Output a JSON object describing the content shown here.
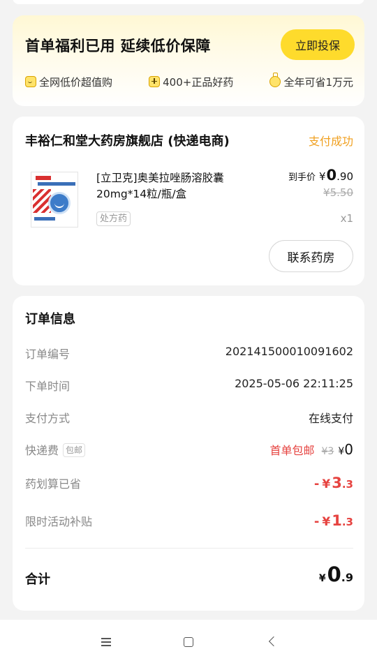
{
  "promo": {
    "title": "首单福利已用 延续低价保障",
    "button_label": "立即投保",
    "perks": [
      {
        "icon": "smile-bag-icon",
        "label": "全网低价超值购"
      },
      {
        "icon": "medicine-plus-icon",
        "label": "400+正品好药"
      },
      {
        "icon": "medal-icon",
        "label": "全年可省1万元"
      }
    ]
  },
  "shop": {
    "name": "丰裕仁和堂大药房旗舰店 (快递电商)",
    "status": "支付成功",
    "product": {
      "title": "[立卫克]奥美拉唑肠溶胶囊20mg*14粒/瓶/盒",
      "tag": "处方药",
      "price_label": "到手价",
      "price_yen": "¥",
      "price_int": "0",
      "price_dec": ".90",
      "original_price": "¥5.50",
      "quantity": "x1"
    },
    "contact_label": "联系药房"
  },
  "order": {
    "title": "订单信息",
    "order_no_label": "订单编号",
    "order_no": "2021415000100916​02",
    "time_label": "下单时间",
    "time": "2025-05-06 22:11:25",
    "payment_label": "支付方式",
    "payment": "在线支付",
    "shipping_label": "快递费",
    "shipping_tag": "包邮",
    "shipping_free": "首单包邮",
    "shipping_orig": "¥3",
    "shipping_yen": "¥",
    "shipping_now": "0",
    "saved_label": "药划算已省",
    "saved_minus": "-",
    "saved_yen": "¥",
    "saved_int": "3",
    "saved_dec": ".3",
    "subsidy_label": "限时活动补贴",
    "subsidy_minus": "-",
    "subsidy_yen": "¥",
    "subsidy_int": "1",
    "subsidy_dec": ".3",
    "total_label": "合计",
    "total_yen": "¥",
    "total_int": "0",
    "total_dec": ".9"
  },
  "colors": {
    "accent_yellow": "#fedb2c",
    "status_orange": "#f0a020",
    "discount_red": "#e64340"
  }
}
